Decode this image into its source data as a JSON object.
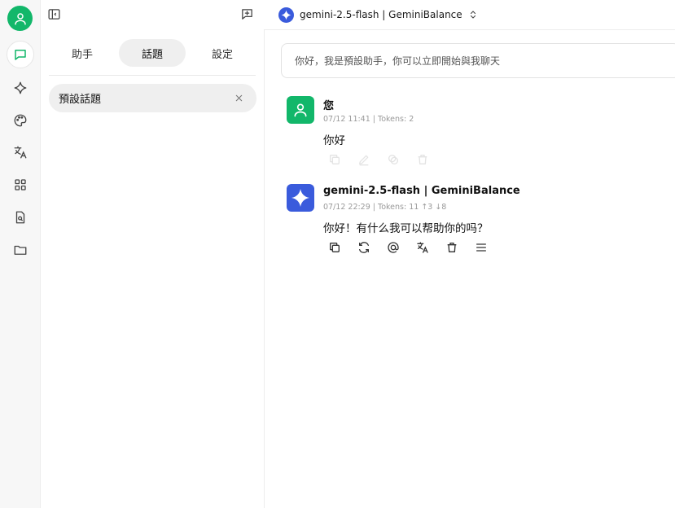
{
  "topbar": {
    "model_name": "gemini-2.5-flash | GeminiBalance"
  },
  "panel": {
    "tabs": [
      {
        "label": "助手"
      },
      {
        "label": "話題"
      },
      {
        "label": "設定"
      }
    ],
    "active_tab": "話題",
    "topics": [
      {
        "title": "預設話題"
      }
    ]
  },
  "chat": {
    "system_prompt": "你好，我是預設助手，你可以立即開始與我聊天",
    "messages": [
      {
        "author": "您",
        "meta": "07/12 11:41  |  Tokens: 2",
        "text": "你好"
      },
      {
        "author": "gemini-2.5-flash | GeminiBalance",
        "meta": "07/12 22:29  |  Tokens: 11 ↑3 ↓8",
        "text": "你好！有什么我可以帮助你的吗？"
      }
    ]
  },
  "colors": {
    "user_avatar": "#12b76a",
    "model_logo": "#3a5bdc",
    "active_tab_bg": "#efefef"
  },
  "icons": {
    "rail": [
      "chat-icon",
      "sparkle-icon",
      "palette-icon",
      "translate-icon",
      "apps-grid-icon",
      "document-search-icon",
      "folder-icon"
    ],
    "message_actions": [
      "copy-icon",
      "regenerate-icon",
      "mention-icon",
      "translate-icon",
      "delete-icon",
      "menu-icon"
    ]
  }
}
